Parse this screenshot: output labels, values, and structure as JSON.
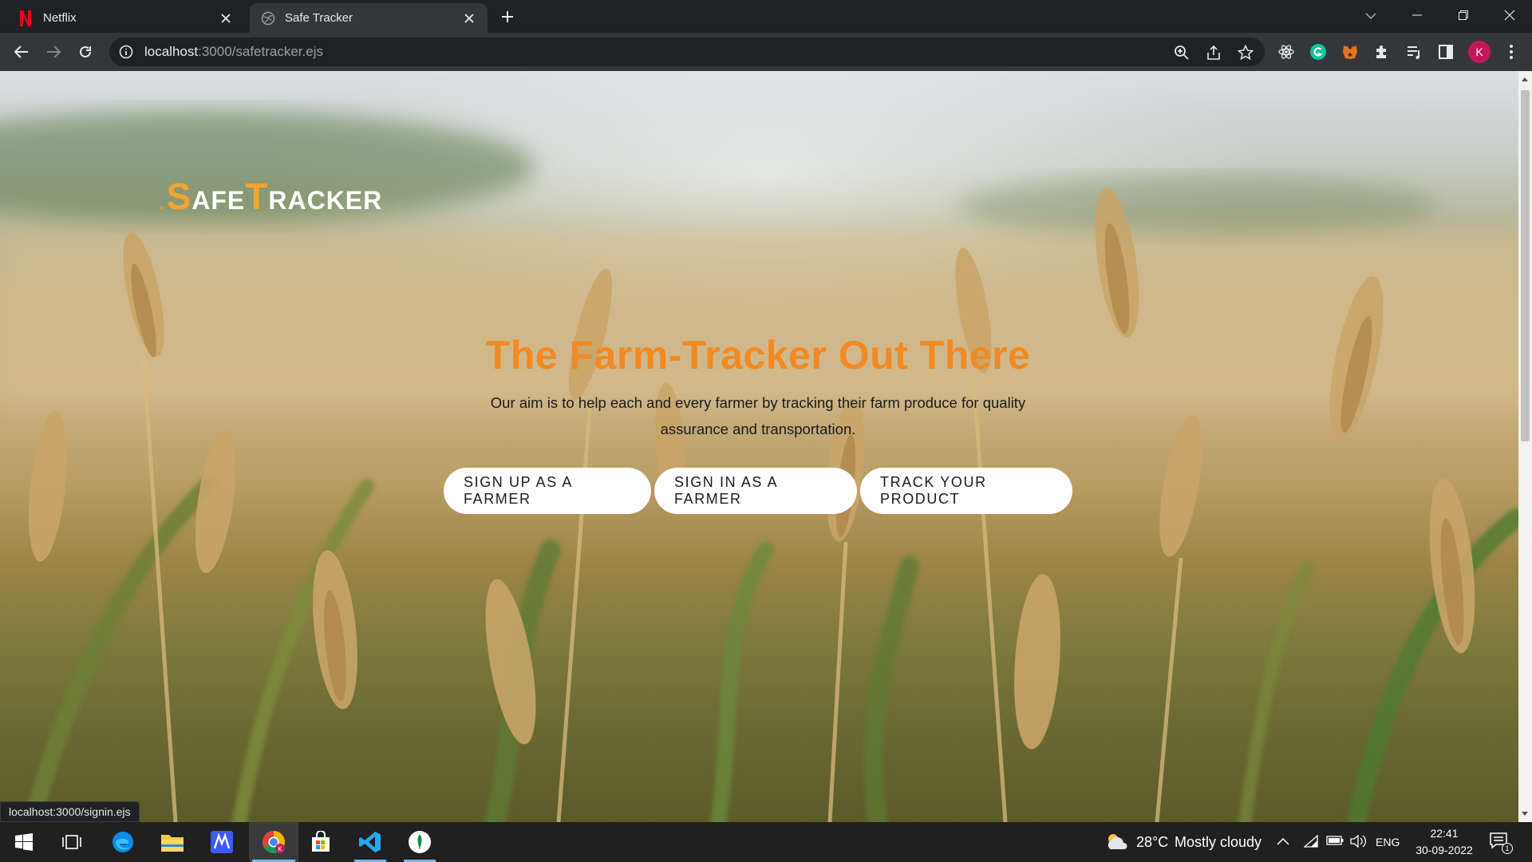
{
  "browser": {
    "tabs": [
      {
        "title": "Netflix",
        "active": false
      },
      {
        "title": "Safe Tracker",
        "active": true
      }
    ],
    "url_host": "localhost",
    "url_path": ":3000/safetracker.ejs",
    "profile_initial": "K",
    "status_url": "localhost:3000/signin.ejs"
  },
  "page": {
    "logo": {
      "dot": ".",
      "word1_cap": "S",
      "word1_rest": "AFE",
      "word2_cap": "T",
      "word2_rest": "RACKER"
    },
    "hero": {
      "title": "The Farm-Tracker Out There",
      "subtitle": "Our aim is to help each and every farmer by tracking their farm produce for quality assurance and transportation."
    },
    "buttons": {
      "signup": "SIGN UP AS A FARMER",
      "signin": "SIGN IN AS A FARMER",
      "track": "TRACK YOUR PRODUCT"
    }
  },
  "taskbar": {
    "weather_temp": "28°C",
    "weather_desc": "Mostly cloudy",
    "language": "ENG",
    "time": "22:41",
    "date": "30-09-2022",
    "notification_count": "1"
  },
  "colors": {
    "accent_orange": "#f08a24",
    "logo_orange": "#f7a42f",
    "chrome_dark": "#202124",
    "chrome_toolbar": "#35363a"
  }
}
